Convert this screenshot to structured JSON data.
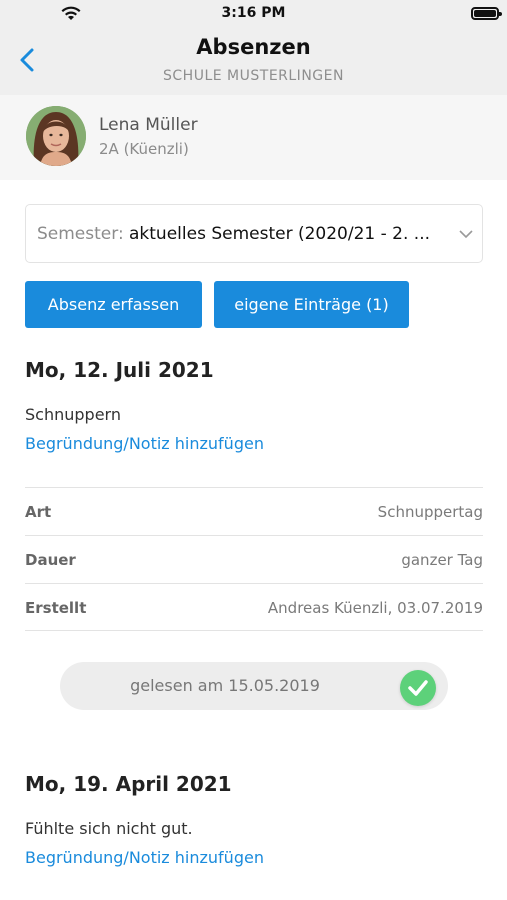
{
  "statusbar": {
    "time": "3:16 PM",
    "wifi_icon": "wifi-icon",
    "battery_icon": "battery-icon"
  },
  "navbar": {
    "back_icon": "chevron-left-icon",
    "title": "Absenzen",
    "subtitle": "SCHULE MUSTERLINGEN"
  },
  "user": {
    "name": "Lena Müller",
    "class": "2A (Küenzli)"
  },
  "semester": {
    "label": "Semester:",
    "value": "aktuelles Semester (2020/21 - 2. ..."
  },
  "actions": {
    "add_label": "Absenz erfassen",
    "own_label": "eigene Einträge (1)"
  },
  "colors": {
    "accent": "#1a8bdc",
    "check": "#5dd17a",
    "header_bg": "#efefef"
  },
  "entries": [
    {
      "date": "Mo, 12. Juli 2021",
      "reason": "Schnuppern",
      "link": "Begründung/Notiz hinzufügen",
      "details": [
        {
          "key": "Art",
          "value": "Schnuppertag"
        },
        {
          "key": "Dauer",
          "value": "ganzer Tag"
        },
        {
          "key": "Erstellt",
          "value": "Andreas Küenzli, 03.07.2019"
        }
      ],
      "read_status": "gelesen am 15.05.2019"
    },
    {
      "date": "Mo, 19. April 2021",
      "reason": "Fühlte sich nicht gut.",
      "link": "Begründung/Notiz hinzufügen"
    }
  ]
}
